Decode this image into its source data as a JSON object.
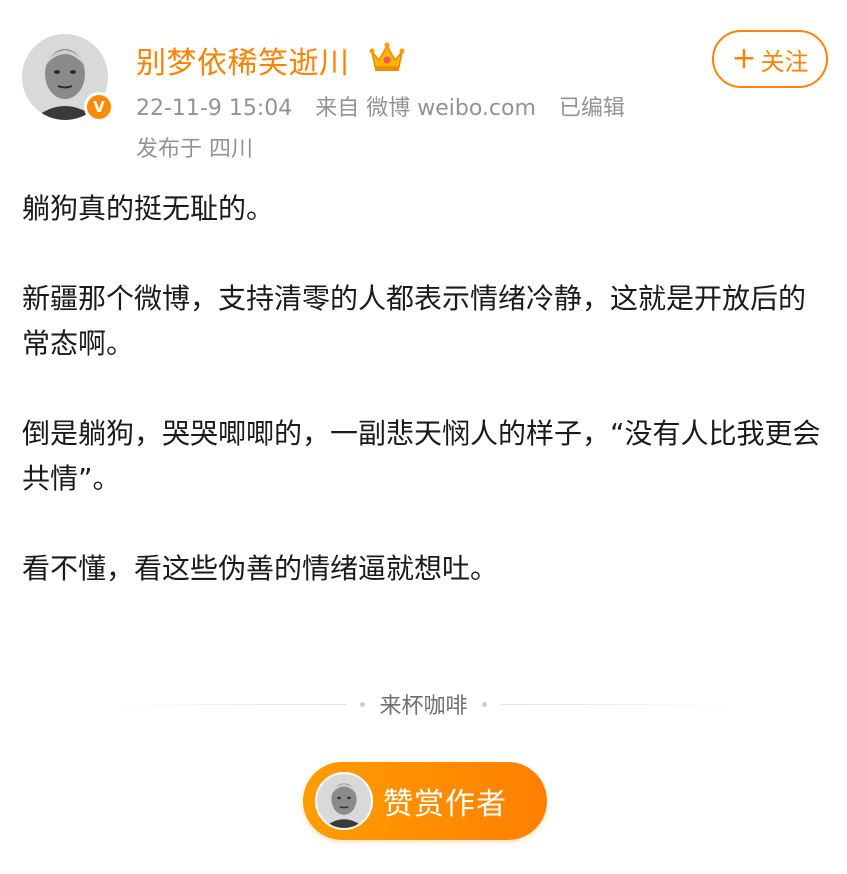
{
  "post": {
    "author": {
      "name": "别梦依稀笑逝川",
      "verified_badge": "V",
      "avatar_icon": "avatar-portrait",
      "vip_icon": "crown-icon"
    },
    "timestamp": "22-11-9 15:04",
    "source": "来自 微博 weibo.com",
    "edited": "已编辑",
    "location": "发布于 四川",
    "follow_button": {
      "plus": "+",
      "label": "关注"
    },
    "paragraphs": [
      "躺狗真的挺无耻的。",
      "新疆那个微博，支持清零的人都表示情绪冷静，这就是开放后的常态啊。",
      "倒是躺狗，哭哭唧唧的，一副悲天悯人的样子，“没有人比我更会共情”。",
      "看不懂，看这些伪善的情绪逼就想吐。"
    ]
  },
  "tip_section": {
    "divider_label": "来杯咖啡",
    "button_label": "赞赏作者"
  },
  "colors": {
    "accent": "#ff8200",
    "meta_text": "#939393",
    "body_text": "#1a1a1a"
  }
}
